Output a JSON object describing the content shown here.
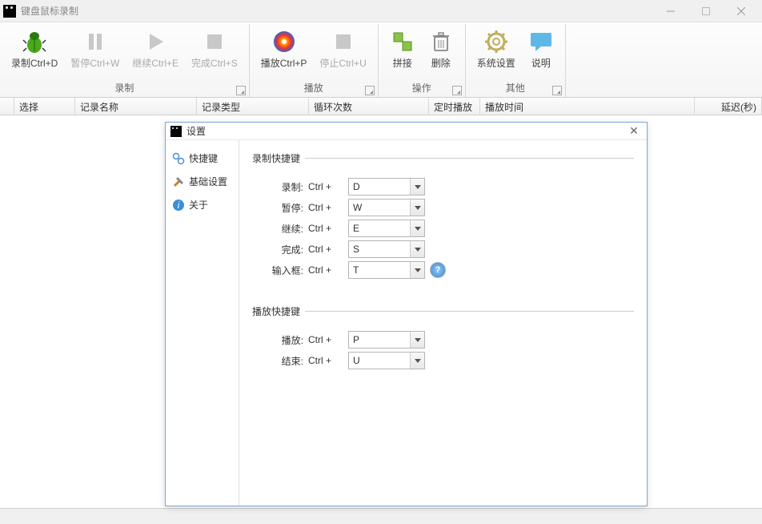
{
  "window": {
    "title": "键盘鼠标录制"
  },
  "ribbon": {
    "groups": [
      {
        "label": "录制",
        "buttons": [
          {
            "label": "录制Ctrl+D"
          },
          {
            "label": "暂停Ctrl+W"
          },
          {
            "label": "继续Ctrl+E"
          },
          {
            "label": "完成Ctrl+S"
          }
        ]
      },
      {
        "label": "播放",
        "buttons": [
          {
            "label": "播放Ctrl+P"
          },
          {
            "label": "停止Ctrl+U"
          }
        ]
      },
      {
        "label": "操作",
        "buttons": [
          {
            "label": "拼接"
          },
          {
            "label": "删除"
          }
        ]
      },
      {
        "label": "其他",
        "buttons": [
          {
            "label": "系统设置"
          },
          {
            "label": "说明"
          }
        ]
      }
    ]
  },
  "columns": {
    "select": "选择",
    "name": "记录名称",
    "type": "记录类型",
    "loop": "循环次数",
    "sched": "定时播放",
    "playtime": "播放时间",
    "delay": "延迟(秒)"
  },
  "dialog": {
    "title": "设置",
    "nav": {
      "hotkeys": "快捷键",
      "basic": "基础设置",
      "about": "关于"
    },
    "section1": "录制快捷键",
    "section2": "播放快捷键",
    "ctrl_prefix": "Ctrl +",
    "rows": {
      "record": {
        "label": "录制:",
        "value": "D"
      },
      "pause": {
        "label": "暂停:",
        "value": "W"
      },
      "resume": {
        "label": "继续:",
        "value": "E"
      },
      "finish": {
        "label": "完成:",
        "value": "S"
      },
      "input": {
        "label": "输入框:",
        "value": "T"
      },
      "play": {
        "label": "播放:",
        "value": "P"
      },
      "end": {
        "label": "结束:",
        "value": "U"
      }
    }
  }
}
